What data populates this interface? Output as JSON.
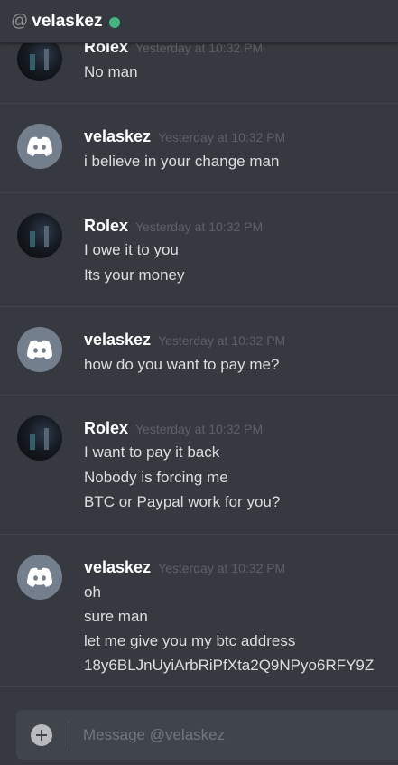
{
  "header": {
    "at_symbol": "@",
    "username": "velaskez",
    "status_color": "#43b581"
  },
  "avatars": {
    "velaskez": "discord-logo-icon",
    "Rolex": "user-photo"
  },
  "messages": [
    {
      "author": "Rolex",
      "timestamp": "Yesterday at 10:32 PM",
      "lines": [
        "No man"
      ]
    },
    {
      "author": "velaskez",
      "timestamp": "Yesterday at 10:32 PM",
      "lines": [
        "i believe in your change man"
      ]
    },
    {
      "author": "Rolex",
      "timestamp": "Yesterday at 10:32 PM",
      "lines": [
        "I owe it to you",
        "Its your money"
      ]
    },
    {
      "author": "velaskez",
      "timestamp": "Yesterday at 10:32 PM",
      "lines": [
        "how do you want to pay me?"
      ]
    },
    {
      "author": "Rolex",
      "timestamp": "Yesterday at 10:32 PM",
      "lines": [
        "I want to pay it back",
        "Nobody is forcing me",
        "BTC or Paypal work for you?"
      ]
    },
    {
      "author": "velaskez",
      "timestamp": "Yesterday at 10:32 PM",
      "lines": [
        "oh",
        "sure man",
        "let me give you my btc address",
        "18y6BLJnUyiArbRiPfXta2Q9NPyo6RFY9Z"
      ]
    }
  ],
  "composer": {
    "placeholder": "Message @velaskez",
    "value": ""
  }
}
